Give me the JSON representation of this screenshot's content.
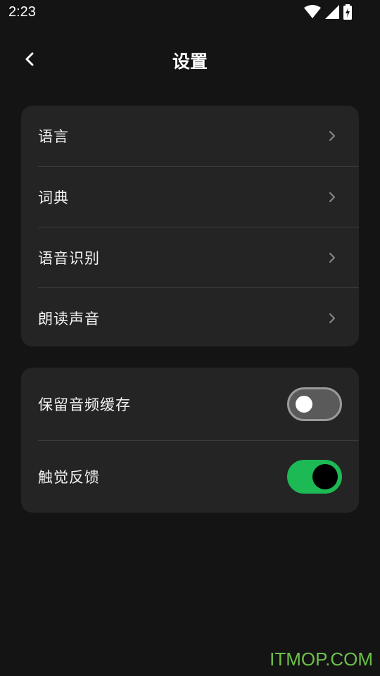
{
  "status_bar": {
    "time": "2:23",
    "icons": [
      "wifi-icon",
      "cellular-signal-icon",
      "battery-charging-icon"
    ]
  },
  "header": {
    "title": "设置",
    "back_icon": "chevron-left-icon"
  },
  "settings_group_1": {
    "items": [
      {
        "label": "语言",
        "icon": "chevron-right-icon"
      },
      {
        "label": "词典",
        "icon": "chevron-right-icon"
      },
      {
        "label": "语音识别",
        "icon": "chevron-right-icon"
      },
      {
        "label": "朗读声音",
        "icon": "chevron-right-icon"
      }
    ]
  },
  "settings_group_2": {
    "items": [
      {
        "label": "保留音频缓存",
        "toggle_on": false
      },
      {
        "label": "触觉反馈",
        "toggle_on": true
      }
    ]
  },
  "watermark": "ITMOP.COM",
  "colors": {
    "background": "#141414",
    "card": "#242424",
    "accent_green": "#1db954",
    "toggle_off": "#5a5a5a",
    "watermark": "#6cc04a"
  }
}
